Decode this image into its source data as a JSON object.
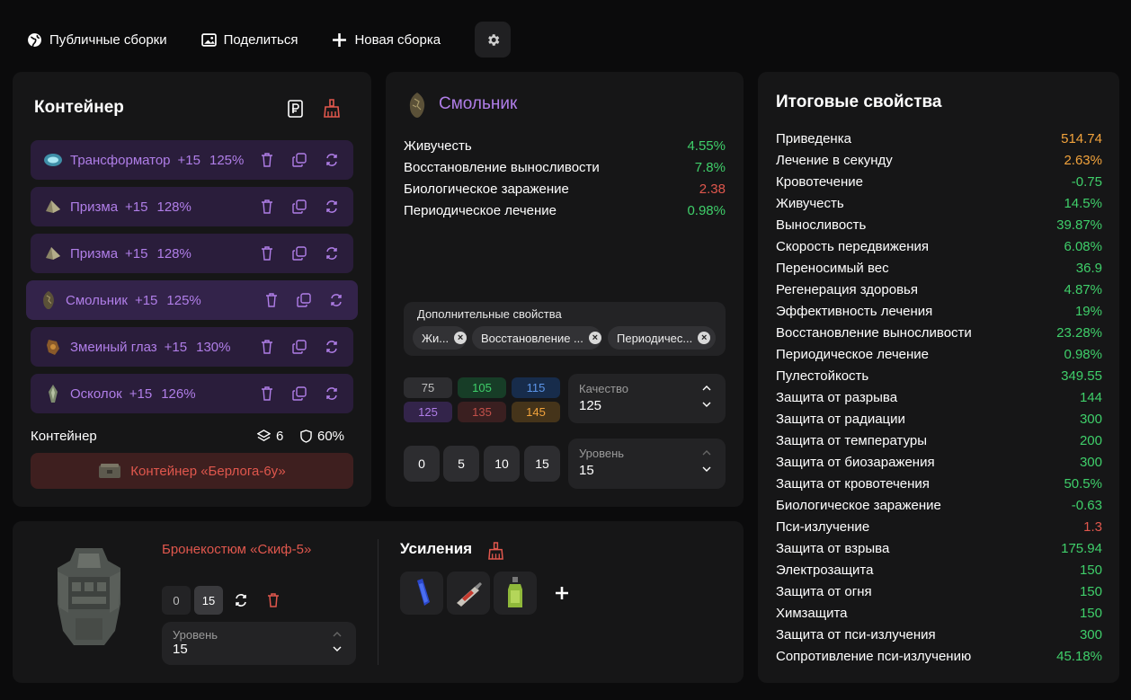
{
  "topbar": {
    "public_builds": "Публичные сборки",
    "share": "Поделиться",
    "new_build": "Новая сборка"
  },
  "container": {
    "title": "Контейнер",
    "artifacts": [
      {
        "name": "Трансформатор",
        "level": "+15",
        "quality": "125%"
      },
      {
        "name": "Призма",
        "level": "+15",
        "quality": "128%"
      },
      {
        "name": "Призма",
        "level": "+15",
        "quality": "128%"
      },
      {
        "name": "Смольник",
        "level": "+15",
        "quality": "125%"
      },
      {
        "name": "Змеиный глаз",
        "level": "+15",
        "quality": "130%"
      },
      {
        "name": "Осколок",
        "level": "+15",
        "quality": "126%"
      }
    ],
    "footer_label": "Контейнер",
    "slots": "6",
    "protection": "60%",
    "container_button": "Контейнер «Берлога-6у»"
  },
  "artifact": {
    "name": "Смольник",
    "stats": [
      {
        "name": "Живучесть",
        "value": "4.55%",
        "color": "green"
      },
      {
        "name": "Восстановление выносливости",
        "value": "7.8%",
        "color": "green"
      },
      {
        "name": "Биологическое заражение",
        "value": "2.38",
        "color": "red"
      },
      {
        "name": "Периодическое лечение",
        "value": "0.98%",
        "color": "green"
      }
    ],
    "extra_title": "Дополнительные свойства",
    "extra_chips": [
      "Жи...",
      "Восстановление ...",
      "Периодичес..."
    ],
    "quality_presets": [
      {
        "value": "75",
        "bg": "#2d2d30",
        "fg": "#bdbdbd"
      },
      {
        "value": "105",
        "bg": "#173d27",
        "fg": "#3fcf6a"
      },
      {
        "value": "115",
        "bg": "#172c4b",
        "fg": "#5c95e8"
      },
      {
        "value": "125",
        "bg": "#33244a",
        "fg": "#b07ee8"
      },
      {
        "value": "135",
        "bg": "#3a1f20",
        "fg": "#c2504a"
      },
      {
        "value": "145",
        "bg": "#45341a",
        "fg": "#f2a33c"
      }
    ],
    "quality_label": "Качество",
    "quality_value": "125",
    "level_presets": [
      "0",
      "5",
      "10",
      "15"
    ],
    "level_label": "Уровень",
    "level_value": "15"
  },
  "totals": {
    "title": "Итоговые свойства",
    "rows": [
      {
        "name": "Приведенка",
        "value": "514.74",
        "color": "orange"
      },
      {
        "name": "Лечение в секунду",
        "value": "2.63%",
        "color": "orange"
      },
      {
        "name": "Кровотечение",
        "value": "-0.75",
        "color": "green"
      },
      {
        "name": "Живучесть",
        "value": "14.5%",
        "color": "green"
      },
      {
        "name": "Выносливость",
        "value": "39.87%",
        "color": "green"
      },
      {
        "name": "Скорость передвижения",
        "value": "6.08%",
        "color": "green"
      },
      {
        "name": "Переносимый вес",
        "value": "36.9",
        "color": "green"
      },
      {
        "name": "Регенерация здоровья",
        "value": "4.87%",
        "color": "green"
      },
      {
        "name": "Эффективность лечения",
        "value": "19%",
        "color": "green"
      },
      {
        "name": "Восстановление выносливости",
        "value": "23.28%",
        "color": "green"
      },
      {
        "name": "Периодическое лечение",
        "value": "0.98%",
        "color": "green"
      },
      {
        "name": "Пулестойкость",
        "value": "349.55",
        "color": "green"
      },
      {
        "name": "Защита от разрыва",
        "value": "144",
        "color": "green"
      },
      {
        "name": "Защита от радиации",
        "value": "300",
        "color": "green"
      },
      {
        "name": "Защита от температуры",
        "value": "200",
        "color": "green"
      },
      {
        "name": "Защита от биозаражения",
        "value": "300",
        "color": "green"
      },
      {
        "name": "Защита от кровотечения",
        "value": "50.5%",
        "color": "green"
      },
      {
        "name": "Биологическое заражение",
        "value": "-0.63",
        "color": "green"
      },
      {
        "name": "Пси-излучение",
        "value": "1.3",
        "color": "red"
      },
      {
        "name": "Защита от взрыва",
        "value": "175.94",
        "color": "green"
      },
      {
        "name": "Электрозащита",
        "value": "150",
        "color": "green"
      },
      {
        "name": "Защита от огня",
        "value": "150",
        "color": "green"
      },
      {
        "name": "Химзащита",
        "value": "150",
        "color": "green"
      },
      {
        "name": "Защита от пси-излучения",
        "value": "300",
        "color": "green"
      },
      {
        "name": "Сопротивление пси-излучению",
        "value": "45.18%",
        "color": "green"
      }
    ]
  },
  "armor": {
    "name": "Бронекостюм «Скиф-5»",
    "level_buttons": [
      "0",
      "15"
    ],
    "level_label": "Уровень",
    "level_value": "15",
    "boosts_title": "Усиления"
  },
  "colors": {
    "accent_purple": "#b07ee8",
    "green": "#3fcf6a",
    "red": "#e0574d",
    "orange": "#f2a33c"
  }
}
